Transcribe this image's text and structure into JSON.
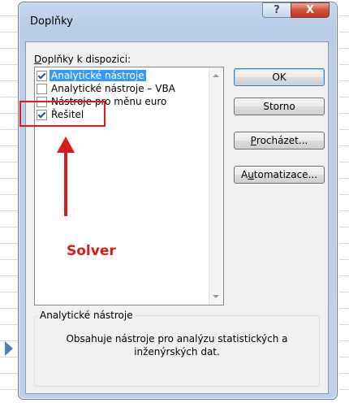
{
  "window": {
    "title": "Doplňky",
    "help_glyph": "?",
    "close_glyph": "X"
  },
  "list": {
    "label_accel": "D",
    "label_rest": "oplňky k dispozici:",
    "items": [
      {
        "label": "Analytické nástroje",
        "checked": true,
        "selected": true
      },
      {
        "label": "Analytické nástroje – VBA",
        "checked": false,
        "selected": false
      },
      {
        "label": "Nástroje pro měnu euro",
        "checked": false,
        "selected": false
      },
      {
        "label": "Řešitel",
        "checked": true,
        "selected": false
      }
    ]
  },
  "buttons": {
    "ok": "OK",
    "cancel": "Storno",
    "browse_accel": "P",
    "browse_rest": "rocházet...",
    "automation_pre": "A",
    "automation_accel": "u",
    "automation_rest": "tomatizace..."
  },
  "description": {
    "title": "Analytické nástroje",
    "text": "Obsahuje nástroje pro analýzu statistických a inženýrských dat."
  },
  "annotation": {
    "label": "Solver",
    "color": "#d81b1b"
  }
}
